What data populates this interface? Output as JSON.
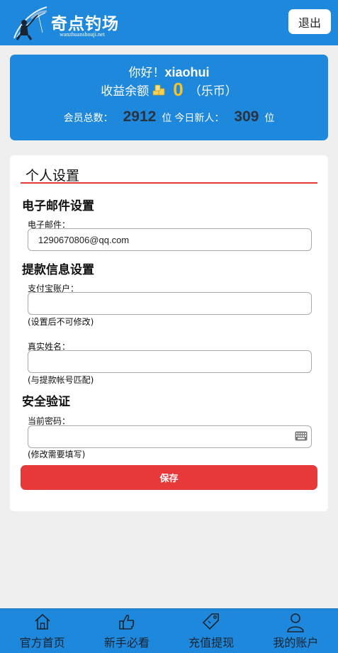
{
  "header": {
    "logo_title": "奇点钓场",
    "logo_subtitle": "wanzhuanshouji.net",
    "logout_label": "退出"
  },
  "info": {
    "greeting_prefix": "你好！",
    "username": "xiaohui",
    "balance_label": "收益余额",
    "balance_value": "0",
    "balance_unit": "（乐币）",
    "members_label": "会员总数：",
    "members_value": "2912",
    "unit_wei_1": "位",
    "today_label": "今日新人：",
    "today_value": "309",
    "unit_wei_2": "位"
  },
  "settings": {
    "title": "个人设置",
    "email_section": "电子邮件设置",
    "email_label": "电子邮件：",
    "email_value": "1290670806@qq.com",
    "withdraw_section": "提款信息设置",
    "alipay_label": "支付宝账户：",
    "alipay_value": "",
    "alipay_hint": "(设置后不可修改)",
    "realname_label": "真实姓名：",
    "realname_value": "",
    "realname_hint": "(与提款帐号匹配)",
    "security_section": "安全验证",
    "password_label": "当前密码：",
    "password_value": "",
    "password_hint": "(修改需要填写)",
    "save_label": "保存"
  },
  "nav": {
    "items": [
      {
        "label": "官方首页",
        "icon": "home-icon"
      },
      {
        "label": "新手必看",
        "icon": "thumbs-up-icon"
      },
      {
        "label": "充值提现",
        "icon": "tag-icon"
      },
      {
        "label": "我的账户",
        "icon": "user-icon"
      }
    ]
  },
  "colors": {
    "primary": "#1e88dc",
    "accent_red": "#e8393a",
    "balance_yellow": "#f7c22a"
  }
}
